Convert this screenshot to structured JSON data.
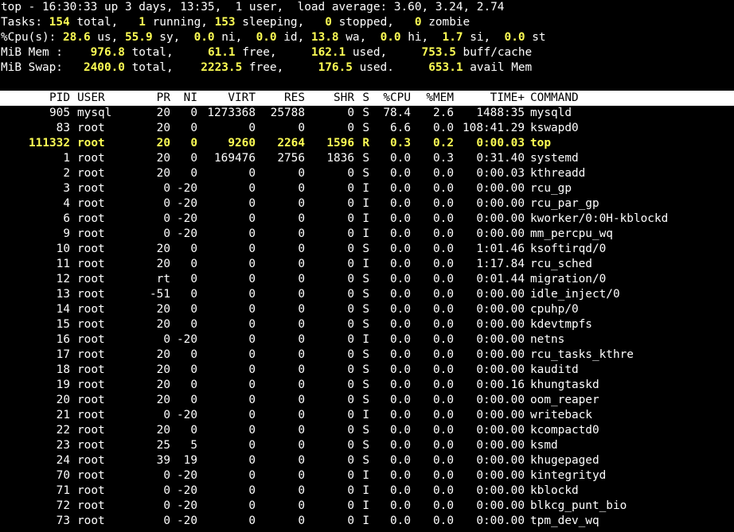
{
  "colors": {
    "background": "#000000",
    "text": "#ffffff",
    "highlight": "#ffff54",
    "header_bg": "#ffffff"
  },
  "summary": {
    "uptime_line": "top - 16:30:33 up 3 days, 13:35,  1 user,  load average: 3.60, 3.24, 2.74",
    "tasks": {
      "label": "Tasks:",
      "total": "154",
      "running": "1",
      "sleeping": "153",
      "stopped": "0",
      "zombie": "0"
    },
    "cpu": {
      "label": "%Cpu(s):",
      "us": "28.6",
      "sy": "55.9",
      "ni": "0.0",
      "id": "0.0",
      "wa": "13.8",
      "hi": "0.0",
      "si": "1.7",
      "st": "0.0"
    },
    "mem": {
      "label": "MiB Mem :",
      "total": "976.8",
      "free": "61.1",
      "used": "162.1",
      "buff_cache": "753.5"
    },
    "swap": {
      "label": "MiB Swap:",
      "total": "2400.0",
      "free": "2223.5",
      "used": "176.5",
      "avail_mem": "653.1"
    }
  },
  "columns": [
    "PID",
    "USER",
    "PR",
    "NI",
    "VIRT",
    "RES",
    "SHR",
    "S",
    "%CPU",
    "%MEM",
    "TIME+",
    "COMMAND"
  ],
  "processes": [
    {
      "pid": "905",
      "user": "mysql",
      "pr": "20",
      "ni": "0",
      "virt": "1273368",
      "res": "25788",
      "shr": "0",
      "s": "S",
      "cpu": "78.4",
      "mem": "2.6",
      "time": "1488:35",
      "cmd": "mysqld"
    },
    {
      "pid": "83",
      "user": "root",
      "pr": "20",
      "ni": "0",
      "virt": "0",
      "res": "0",
      "shr": "0",
      "s": "S",
      "cpu": "6.6",
      "mem": "0.0",
      "time": "108:41.29",
      "cmd": "kswapd0"
    },
    {
      "pid": "111332",
      "user": "root",
      "pr": "20",
      "ni": "0",
      "virt": "9260",
      "res": "2264",
      "shr": "1596",
      "s": "R",
      "cpu": "0.3",
      "mem": "0.2",
      "time": "0:00.03",
      "cmd": "top",
      "highlight": true
    },
    {
      "pid": "1",
      "user": "root",
      "pr": "20",
      "ni": "0",
      "virt": "169476",
      "res": "2756",
      "shr": "1836",
      "s": "S",
      "cpu": "0.0",
      "mem": "0.3",
      "time": "0:31.40",
      "cmd": "systemd"
    },
    {
      "pid": "2",
      "user": "root",
      "pr": "20",
      "ni": "0",
      "virt": "0",
      "res": "0",
      "shr": "0",
      "s": "S",
      "cpu": "0.0",
      "mem": "0.0",
      "time": "0:00.03",
      "cmd": "kthreadd"
    },
    {
      "pid": "3",
      "user": "root",
      "pr": "0",
      "ni": "-20",
      "virt": "0",
      "res": "0",
      "shr": "0",
      "s": "I",
      "cpu": "0.0",
      "mem": "0.0",
      "time": "0:00.00",
      "cmd": "rcu_gp"
    },
    {
      "pid": "4",
      "user": "root",
      "pr": "0",
      "ni": "-20",
      "virt": "0",
      "res": "0",
      "shr": "0",
      "s": "I",
      "cpu": "0.0",
      "mem": "0.0",
      "time": "0:00.00",
      "cmd": "rcu_par_gp"
    },
    {
      "pid": "6",
      "user": "root",
      "pr": "0",
      "ni": "-20",
      "virt": "0",
      "res": "0",
      "shr": "0",
      "s": "I",
      "cpu": "0.0",
      "mem": "0.0",
      "time": "0:00.00",
      "cmd": "kworker/0:0H-kblockd"
    },
    {
      "pid": "9",
      "user": "root",
      "pr": "0",
      "ni": "-20",
      "virt": "0",
      "res": "0",
      "shr": "0",
      "s": "I",
      "cpu": "0.0",
      "mem": "0.0",
      "time": "0:00.00",
      "cmd": "mm_percpu_wq"
    },
    {
      "pid": "10",
      "user": "root",
      "pr": "20",
      "ni": "0",
      "virt": "0",
      "res": "0",
      "shr": "0",
      "s": "S",
      "cpu": "0.0",
      "mem": "0.0",
      "time": "1:01.46",
      "cmd": "ksoftirqd/0"
    },
    {
      "pid": "11",
      "user": "root",
      "pr": "20",
      "ni": "0",
      "virt": "0",
      "res": "0",
      "shr": "0",
      "s": "I",
      "cpu": "0.0",
      "mem": "0.0",
      "time": "1:17.84",
      "cmd": "rcu_sched"
    },
    {
      "pid": "12",
      "user": "root",
      "pr": "rt",
      "ni": "0",
      "virt": "0",
      "res": "0",
      "shr": "0",
      "s": "S",
      "cpu": "0.0",
      "mem": "0.0",
      "time": "0:01.44",
      "cmd": "migration/0"
    },
    {
      "pid": "13",
      "user": "root",
      "pr": "-51",
      "ni": "0",
      "virt": "0",
      "res": "0",
      "shr": "0",
      "s": "S",
      "cpu": "0.0",
      "mem": "0.0",
      "time": "0:00.00",
      "cmd": "idle_inject/0"
    },
    {
      "pid": "14",
      "user": "root",
      "pr": "20",
      "ni": "0",
      "virt": "0",
      "res": "0",
      "shr": "0",
      "s": "S",
      "cpu": "0.0",
      "mem": "0.0",
      "time": "0:00.00",
      "cmd": "cpuhp/0"
    },
    {
      "pid": "15",
      "user": "root",
      "pr": "20",
      "ni": "0",
      "virt": "0",
      "res": "0",
      "shr": "0",
      "s": "S",
      "cpu": "0.0",
      "mem": "0.0",
      "time": "0:00.00",
      "cmd": "kdevtmpfs"
    },
    {
      "pid": "16",
      "user": "root",
      "pr": "0",
      "ni": "-20",
      "virt": "0",
      "res": "0",
      "shr": "0",
      "s": "I",
      "cpu": "0.0",
      "mem": "0.0",
      "time": "0:00.00",
      "cmd": "netns"
    },
    {
      "pid": "17",
      "user": "root",
      "pr": "20",
      "ni": "0",
      "virt": "0",
      "res": "0",
      "shr": "0",
      "s": "S",
      "cpu": "0.0",
      "mem": "0.0",
      "time": "0:00.00",
      "cmd": "rcu_tasks_kthre"
    },
    {
      "pid": "18",
      "user": "root",
      "pr": "20",
      "ni": "0",
      "virt": "0",
      "res": "0",
      "shr": "0",
      "s": "S",
      "cpu": "0.0",
      "mem": "0.0",
      "time": "0:00.00",
      "cmd": "kauditd"
    },
    {
      "pid": "19",
      "user": "root",
      "pr": "20",
      "ni": "0",
      "virt": "0",
      "res": "0",
      "shr": "0",
      "s": "S",
      "cpu": "0.0",
      "mem": "0.0",
      "time": "0:00.16",
      "cmd": "khungtaskd"
    },
    {
      "pid": "20",
      "user": "root",
      "pr": "20",
      "ni": "0",
      "virt": "0",
      "res": "0",
      "shr": "0",
      "s": "S",
      "cpu": "0.0",
      "mem": "0.0",
      "time": "0:00.00",
      "cmd": "oom_reaper"
    },
    {
      "pid": "21",
      "user": "root",
      "pr": "0",
      "ni": "-20",
      "virt": "0",
      "res": "0",
      "shr": "0",
      "s": "I",
      "cpu": "0.0",
      "mem": "0.0",
      "time": "0:00.00",
      "cmd": "writeback"
    },
    {
      "pid": "22",
      "user": "root",
      "pr": "20",
      "ni": "0",
      "virt": "0",
      "res": "0",
      "shr": "0",
      "s": "S",
      "cpu": "0.0",
      "mem": "0.0",
      "time": "0:00.00",
      "cmd": "kcompactd0"
    },
    {
      "pid": "23",
      "user": "root",
      "pr": "25",
      "ni": "5",
      "virt": "0",
      "res": "0",
      "shr": "0",
      "s": "S",
      "cpu": "0.0",
      "mem": "0.0",
      "time": "0:00.00",
      "cmd": "ksmd"
    },
    {
      "pid": "24",
      "user": "root",
      "pr": "39",
      "ni": "19",
      "virt": "0",
      "res": "0",
      "shr": "0",
      "s": "S",
      "cpu": "0.0",
      "mem": "0.0",
      "time": "0:00.00",
      "cmd": "khugepaged"
    },
    {
      "pid": "70",
      "user": "root",
      "pr": "0",
      "ni": "-20",
      "virt": "0",
      "res": "0",
      "shr": "0",
      "s": "I",
      "cpu": "0.0",
      "mem": "0.0",
      "time": "0:00.00",
      "cmd": "kintegrityd"
    },
    {
      "pid": "71",
      "user": "root",
      "pr": "0",
      "ni": "-20",
      "virt": "0",
      "res": "0",
      "shr": "0",
      "s": "I",
      "cpu": "0.0",
      "mem": "0.0",
      "time": "0:00.00",
      "cmd": "kblockd"
    },
    {
      "pid": "72",
      "user": "root",
      "pr": "0",
      "ni": "-20",
      "virt": "0",
      "res": "0",
      "shr": "0",
      "s": "I",
      "cpu": "0.0",
      "mem": "0.0",
      "time": "0:00.00",
      "cmd": "blkcg_punt_bio"
    },
    {
      "pid": "73",
      "user": "root",
      "pr": "0",
      "ni": "-20",
      "virt": "0",
      "res": "0",
      "shr": "0",
      "s": "I",
      "cpu": "0.0",
      "mem": "0.0",
      "time": "0:00.00",
      "cmd": "tpm_dev_wq"
    }
  ]
}
